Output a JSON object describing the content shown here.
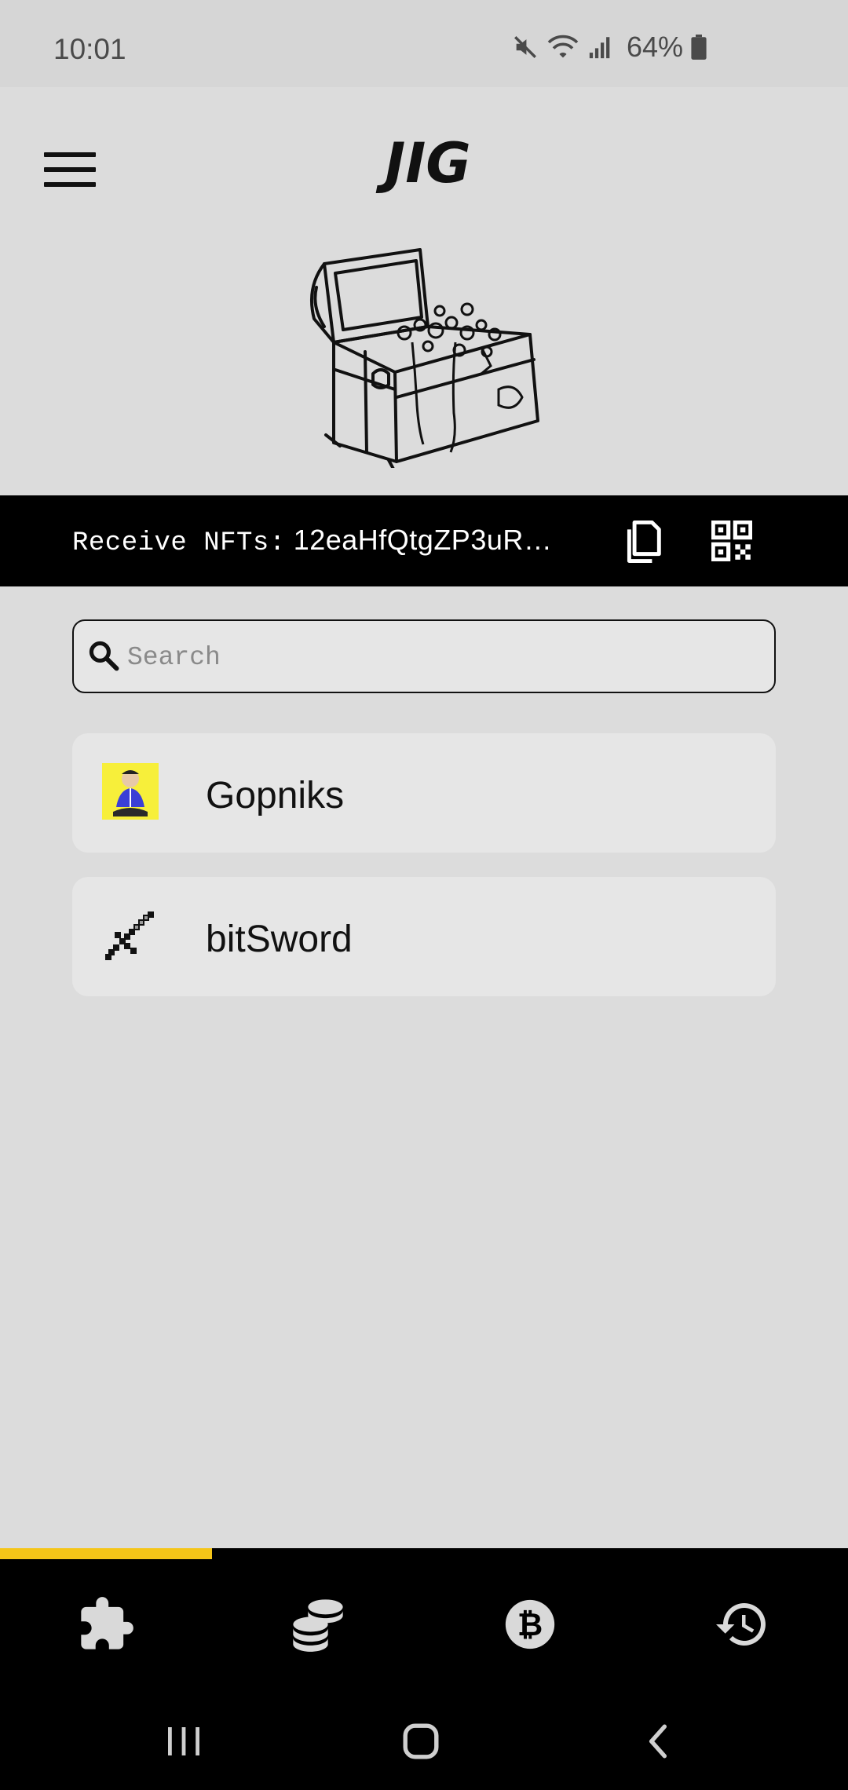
{
  "status_bar": {
    "time": "10:01",
    "battery": "64%"
  },
  "header": {
    "app_name": "JIG"
  },
  "receive": {
    "label": "Receive NFTs:",
    "address": "12eaHfQtgZP3uR…"
  },
  "search": {
    "placeholder": "Search",
    "value": ""
  },
  "collections": [
    {
      "name": "Gopniks",
      "icon": "gopnik-avatar"
    },
    {
      "name": "bitSword",
      "icon": "pixel-sword"
    }
  ],
  "progress": {
    "fraction": 0.25,
    "color": "#f5c518"
  },
  "bottom_nav": [
    {
      "icon": "puzzle-icon"
    },
    {
      "icon": "coins-icon"
    },
    {
      "icon": "bitcoin-icon"
    },
    {
      "icon": "history-icon"
    }
  ],
  "colors": {
    "background": "#dcdcdc",
    "accent": "#f5c518",
    "bar": "#000000"
  }
}
